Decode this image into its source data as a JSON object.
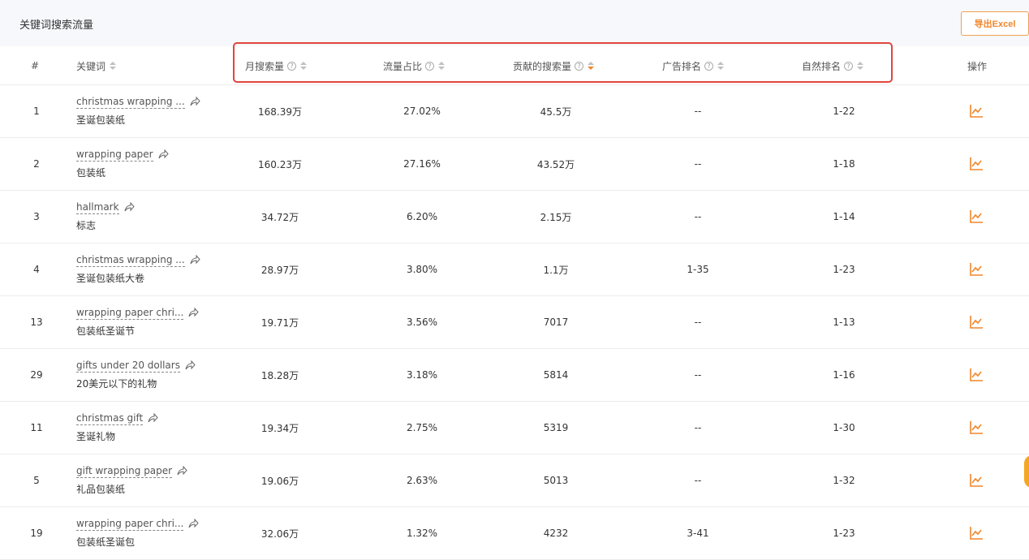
{
  "section": {
    "title": "关键词搜索流量",
    "export_label": "导出Excel"
  },
  "columns": {
    "idx": "#",
    "keyword": "关键词",
    "monthly": "月搜索量",
    "ratio": "流量占比",
    "contrib": "贡献的搜索量",
    "ad_rank": "广告排名",
    "natural_rank": "自然排名",
    "action": "操作",
    "help_glyph": "?"
  },
  "rows": [
    {
      "idx": "1",
      "kw_en": "christmas wrapping ...",
      "kw_zh": "圣诞包装纸",
      "monthly": "168.39万",
      "ratio": "27.02%",
      "contrib": "45.5万",
      "ad": "--",
      "nat": "1-22"
    },
    {
      "idx": "2",
      "kw_en": "wrapping paper",
      "kw_zh": "包装纸",
      "monthly": "160.23万",
      "ratio": "27.16%",
      "contrib": "43.52万",
      "ad": "--",
      "nat": "1-18"
    },
    {
      "idx": "3",
      "kw_en": "hallmark",
      "kw_zh": "标志",
      "monthly": "34.72万",
      "ratio": "6.20%",
      "contrib": "2.15万",
      "ad": "--",
      "nat": "1-14"
    },
    {
      "idx": "4",
      "kw_en": "christmas wrapping ...",
      "kw_zh": "圣诞包装纸大卷",
      "monthly": "28.97万",
      "ratio": "3.80%",
      "contrib": "1.1万",
      "ad": "1-35",
      "nat": "1-23"
    },
    {
      "idx": "13",
      "kw_en": "wrapping paper chri...",
      "kw_zh": "包装纸圣诞节",
      "monthly": "19.71万",
      "ratio": "3.56%",
      "contrib": "7017",
      "ad": "--",
      "nat": "1-13"
    },
    {
      "idx": "29",
      "kw_en": "gifts under 20 dollars",
      "kw_zh": "20美元以下的礼物",
      "monthly": "18.28万",
      "ratio": "3.18%",
      "contrib": "5814",
      "ad": "--",
      "nat": "1-16"
    },
    {
      "idx": "11",
      "kw_en": "christmas gift",
      "kw_zh": "圣诞礼物",
      "monthly": "19.34万",
      "ratio": "2.75%",
      "contrib": "5319",
      "ad": "--",
      "nat": "1-30"
    },
    {
      "idx": "5",
      "kw_en": "gift wrapping paper",
      "kw_zh": "礼品包装纸",
      "monthly": "19.06万",
      "ratio": "2.63%",
      "contrib": "5013",
      "ad": "--",
      "nat": "1-32"
    },
    {
      "idx": "19",
      "kw_en": "wrapping paper chri...",
      "kw_zh": "包装纸圣诞包",
      "monthly": "32.06万",
      "ratio": "1.32%",
      "contrib": "4232",
      "ad": "3-41",
      "nat": "1-23"
    }
  ],
  "icons": {
    "share": "share-icon",
    "trend": "trend-chart-icon",
    "sort": "sort-icon",
    "help": "help-circle-icon"
  },
  "colors": {
    "accent": "#f0862b",
    "highlight": "#e0453d",
    "header_bg": "#f6f8fc"
  }
}
